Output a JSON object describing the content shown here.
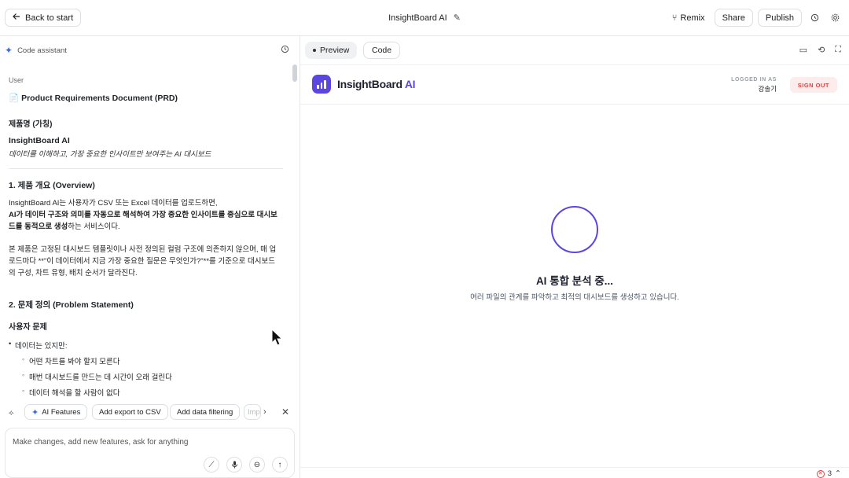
{
  "topbar": {
    "back_label": "Back to start",
    "title": "InsightBoard AI",
    "remix_label": "Remix",
    "share_label": "Share",
    "publish_label": "Publish"
  },
  "assistant": {
    "header": "Code assistant",
    "user_label": "User",
    "doc": {
      "prd_title": "Product Requirements Document (PRD)",
      "product_name_heading": "제품명 (가칭)",
      "product_name": "InsightBoard AI",
      "tagline": "데이터를 이해하고, 가장 중요한 인사이트만 보여주는 AI 대시보드",
      "section1_title": "1. 제품 개요 (Overview)",
      "section1_p1_a": "InsightBoard AI는 사용자가 CSV 또는 Excel 데이터를 업로드하면,",
      "section1_p1_b": "AI가 데이터 구조와 의미를 자동으로 해석하여 가장 중요한 인사이트를 중심으로 대시보드를 동적으로 생성",
      "section1_p1_c": "하는 서비스이다.",
      "section1_p2": "본 제품은 고정된 대시보드 템플릿이나 사전 정의된 컬럼 구조에 의존하지 않으며, 매 업로드마다 **\"이 데이터에서 지금 가장 중요한 질문은 무엇인가?\"**를 기준으로 대시보드의 구성, 차트 유형, 배치 순서가 달라진다.",
      "section2_title": "2. 문제 정의 (Problem Statement)",
      "subheading": "사용자 문제",
      "bullet": "데이터는 있지만:",
      "subbullets": [
        "어떤 차트를 봐야 할지 모른다",
        "매번 대시보드를 만드는 데 시간이 오래 걸린다",
        "데이터 해석을 할 사람이 없다"
      ]
    },
    "chips": [
      "AI Features",
      "Add export to CSV",
      "Add data filtering",
      "Imp"
    ],
    "input_placeholder": "Make changes, add new features, ask for anything"
  },
  "preview": {
    "tab_preview": "Preview",
    "tab_code": "Code",
    "app": {
      "brand_main": "InsightBoard ",
      "brand_ai": "AI",
      "logged_in_label": "LOGGED IN AS",
      "user_name": "강솔기",
      "sign_out": "SIGN OUT",
      "loading_title": "AI 통합 분석 중...",
      "loading_subtitle": "여러 파일의 관계를 파악하고 최적의 대시보드를 생성하고 있습니다."
    },
    "error_count": "3"
  },
  "colors": {
    "accent": "#5b46e0",
    "sign_out_bg": "#fdecec",
    "sign_out_text": "#d64545",
    "spark": "#3b6fd8"
  }
}
